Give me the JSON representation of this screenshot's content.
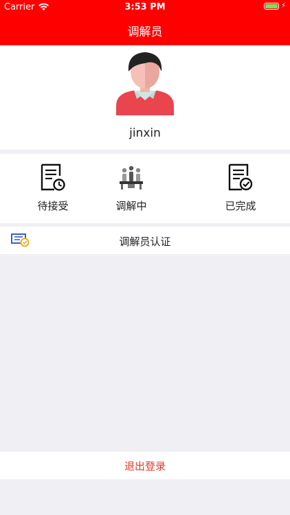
{
  "status_bar": {
    "carrier": "Carrier",
    "time": "3:53 PM",
    "wifi_icon": "wifi-icon",
    "battery_icon": "battery-charging-icon"
  },
  "nav": {
    "title": "调解员"
  },
  "profile": {
    "avatar_icon": "user-avatar-icon",
    "username": "jinxin"
  },
  "actions": [
    {
      "label": "待接受",
      "icon": "document-clock-icon"
    },
    {
      "label": "调解中",
      "icon": "meeting-icon"
    },
    {
      "label": "已完成",
      "icon": "document-check-icon"
    }
  ],
  "certification": {
    "label": "调解员认证",
    "icon": "certificate-badge-icon"
  },
  "logout": {
    "label": "退出登录"
  },
  "colors": {
    "brand_red": "#ff0000",
    "background": "#efeff4",
    "logout_text": "#e03a2a"
  }
}
